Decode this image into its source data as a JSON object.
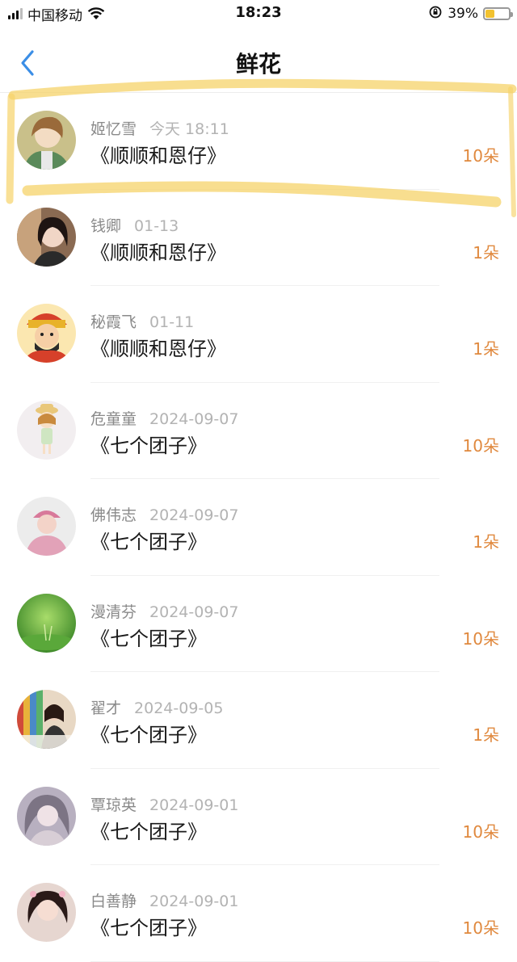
{
  "status_bar": {
    "carrier": "中国移动",
    "time": "18:23",
    "battery_percent": "39%",
    "battery_level": 0.39,
    "icons": [
      "signal-icon",
      "wifi-icon",
      "rotation-lock-icon",
      "battery-icon"
    ]
  },
  "nav": {
    "title": "鲜花",
    "back_icon": "chevron-left-icon",
    "accent_color": "#3b8ee6"
  },
  "colors": {
    "count_color": "#e0893e",
    "highlight_color": "#f6d36a"
  },
  "items": [
    {
      "name": "姬忆雪",
      "date": "今天 18:11",
      "title": "《顺顺和恩仔》",
      "count": "10朵"
    },
    {
      "name": "钱卿",
      "date": "01-13",
      "title": "《顺顺和恩仔》",
      "count": "1朵"
    },
    {
      "name": "秘霞飞",
      "date": "01-11",
      "title": "《顺顺和恩仔》",
      "count": "1朵"
    },
    {
      "name": "危童童",
      "date": "2024-09-07",
      "title": "《七个团子》",
      "count": "10朵"
    },
    {
      "name": "佛伟志",
      "date": "2024-09-07",
      "title": "《七个团子》",
      "count": "1朵"
    },
    {
      "name": "漫清芬",
      "date": "2024-09-07",
      "title": "《七个团子》",
      "count": "10朵"
    },
    {
      "name": "翟才",
      "date": "2024-09-05",
      "title": "《七个团子》",
      "count": "1朵"
    },
    {
      "name": "覃琼英",
      "date": "2024-09-01",
      "title": "《七个团子》",
      "count": "10朵"
    },
    {
      "name": "白善静",
      "date": "2024-09-01",
      "title": "《七个团子》",
      "count": "10朵"
    }
  ]
}
